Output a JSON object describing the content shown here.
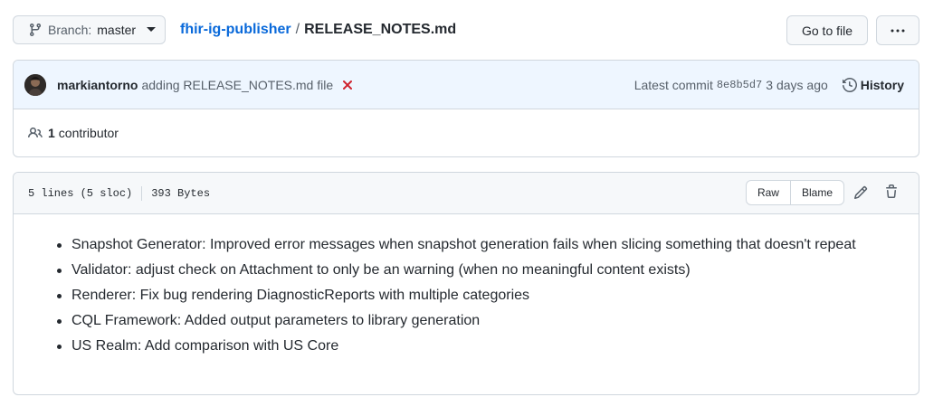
{
  "header": {
    "branch_label": "Branch:",
    "branch_name": "master",
    "repo": "fhir-ig-publisher",
    "separator": "/",
    "file": "RELEASE_NOTES.md",
    "goto_label": "Go to file",
    "more_icon": "kebab-horizontal-icon"
  },
  "commit": {
    "author": "markiantorno",
    "message": "adding RELEASE_NOTES.md file",
    "status": "failed",
    "latest_label": "Latest commit",
    "sha": "8e8b5d7",
    "time": "3 days ago",
    "history_label": "History",
    "status_color": "#cf222e"
  },
  "contributors": {
    "count": "1",
    "label": "contributor"
  },
  "file": {
    "lines": "5 lines (5 sloc)",
    "size": "393 Bytes",
    "raw_label": "Raw",
    "blame_label": "Blame",
    "notes": [
      "Snapshot Generator: Improved error messages when snapshot generation fails when slicing something that doesn't repeat",
      "Validator: adjust check on Attachment to only be an warning (when no meaningful content exists)",
      "Renderer: Fix bug rendering DiagnosticReports with multiple categories",
      "CQL Framework: Added output parameters to library generation",
      "US Realm: Add comparison with US Core"
    ]
  },
  "colors": {
    "link": "#0969da",
    "border": "#d0d7de",
    "commit_bg": "#eef6ff"
  }
}
